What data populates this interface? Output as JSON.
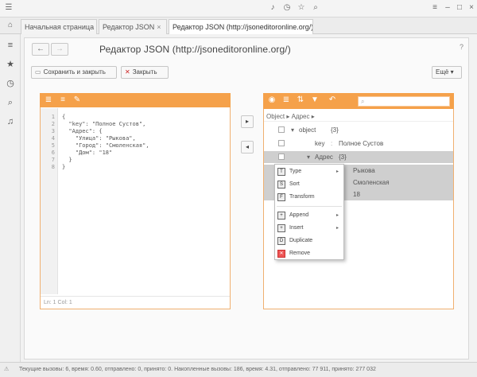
{
  "tabs": [
    {
      "label": "Начальная страница"
    },
    {
      "label": "Редактор JSON",
      "close": "×"
    },
    {
      "label": "Редактор JSON (http://jsoneditoronline.org/)",
      "close": "×"
    }
  ],
  "form": {
    "title": "Редактор JSON (http://jsoneditoronline.org/)",
    "save_close_label": "Сохранить и закрыть",
    "close_label": "Закрыть",
    "more_label": "Ещё",
    "more_caret": "▾",
    "help": "?"
  },
  "left_editor": {
    "line_numbers": [
      "1",
      "2",
      "3",
      "4",
      "5",
      "6",
      "7",
      "8"
    ],
    "code_lines": [
      "{",
      "  \"key\": \"Полное Сустов\",",
      "  \"Адрес\": {",
      "    \"Улица\": \"Рыкова\",",
      "    \"Город\": \"Смоленская\",",
      "    \"Дом\": \"18\"",
      "  }",
      "}"
    ],
    "status": "Ln: 1    Col: 1"
  },
  "transfer": {
    "right": "▸",
    "left": "◂"
  },
  "right_tree": {
    "breadcrumb": "Object ▸  Адрес ▸",
    "rows": [
      {
        "key": "object",
        "value": "{3}"
      },
      {
        "key": "key",
        "value": "Полное Сустов"
      },
      {
        "key": "Адрес",
        "value": "{3}"
      },
      {
        "key": "",
        "value": "Рыкова"
      },
      {
        "key": "",
        "value": "Смоленская"
      },
      {
        "key": "",
        "value": "18"
      }
    ]
  },
  "context_menu": {
    "items": [
      {
        "label": "Type",
        "submenu": "▸",
        "icon": "T"
      },
      {
        "label": "Sort",
        "icon": "S"
      },
      {
        "label": "Transform",
        "icon": "F"
      },
      {
        "label": "Append",
        "submenu": "▸",
        "icon": "+"
      },
      {
        "label": "Insert",
        "submenu": "▸",
        "icon": "+"
      },
      {
        "label": "Duplicate",
        "icon": "D"
      },
      {
        "label": "Remove",
        "icon": "✕"
      }
    ]
  },
  "statusbar": {
    "text": "Текущие вызовы: 6, время: 0.60, отправлено: 0, принято: 0. Накопленные вызовы: 186, время: 4.31, отправлено: 77 911, принято: 277 032"
  }
}
